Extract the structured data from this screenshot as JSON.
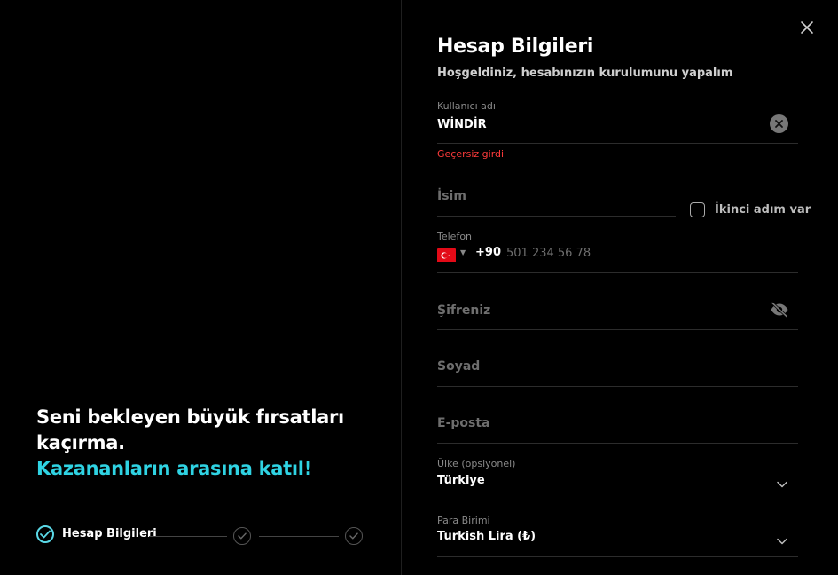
{
  "promo": {
    "line1": "Seni bekleyen büyük fırsatları kaçırma.",
    "line2": "Kazananların arasına katıl!"
  },
  "stepper": {
    "steps": [
      {
        "label": "Hesap Bilgileri",
        "active": true
      },
      {
        "label": "",
        "active": false
      },
      {
        "label": "",
        "active": false
      }
    ]
  },
  "form": {
    "title": "Hesap Bilgileri",
    "subtitle": "Hoşgeldiniz, hesabınızın kurulumunu yapalım",
    "username": {
      "label": "Kullanıcı adı",
      "value": "WİNDİR",
      "error": "Geçersiz girdi"
    },
    "name": {
      "placeholder": "İsim"
    },
    "second_name_checkbox": {
      "label": "İkinci adım var",
      "checked": false
    },
    "phone": {
      "label": "Telefon",
      "country": "TR",
      "dial_code": "+90",
      "placeholder": "501 234 56 78"
    },
    "password": {
      "placeholder": "Şifreniz"
    },
    "surname": {
      "placeholder": "Soyad"
    },
    "email": {
      "placeholder": "E-posta"
    },
    "country": {
      "label": "Ülke (opsiyonel)",
      "value": "Türkiye"
    },
    "currency": {
      "label": "Para Birimi",
      "value": "Turkish Lira (₺)"
    }
  },
  "colors": {
    "accent": "#2fd3e3",
    "error": "#ff3b3b",
    "background": "#000000"
  },
  "icons": {
    "close": "close-icon",
    "clear": "clear-icon",
    "eye_off": "eye-off-icon",
    "chevron": "chevron-down-icon",
    "check": "check-icon"
  }
}
